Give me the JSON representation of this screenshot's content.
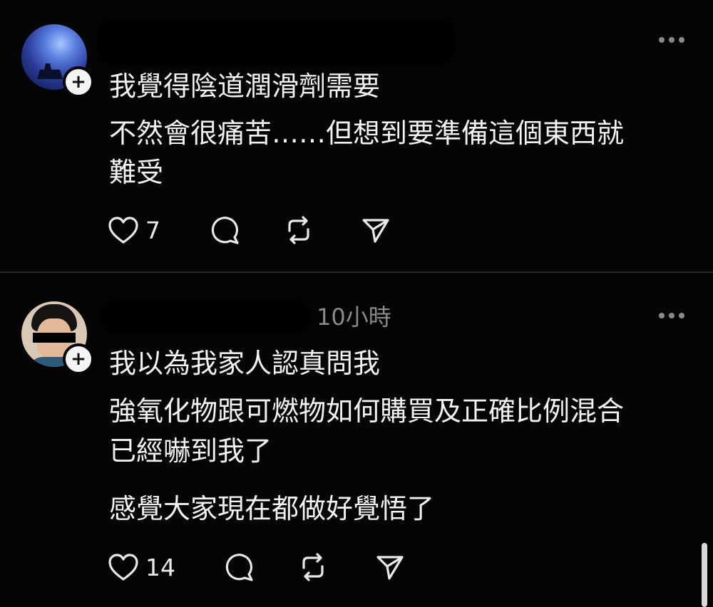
{
  "posts": [
    {
      "author": "",
      "lines": [
        "我覺得陰道潤滑劑需要",
        "不然會很痛苦……但想到要準備這個東西就",
        "難受"
      ],
      "like_count": "7"
    },
    {
      "author": "",
      "timestamp": "10小時",
      "lines": [
        "我以為我家人認真問我",
        "強氧化物跟可燃物如何購買及正確比例混合",
        "已經嚇到我了",
        "感覺大家現在都做好覺悟了"
      ],
      "like_count": "14"
    }
  ],
  "icons": {
    "follow": "plus-icon",
    "more": "more-options-icon",
    "like": "heart-icon",
    "reply": "comment-icon",
    "repost": "repost-icon",
    "share": "send-icon"
  },
  "follow_symbol": "+",
  "colors": {
    "background": "#050505",
    "text": "#f2f2f2",
    "secondary": "#8a8a8a",
    "divider": "#2a2a2a"
  }
}
